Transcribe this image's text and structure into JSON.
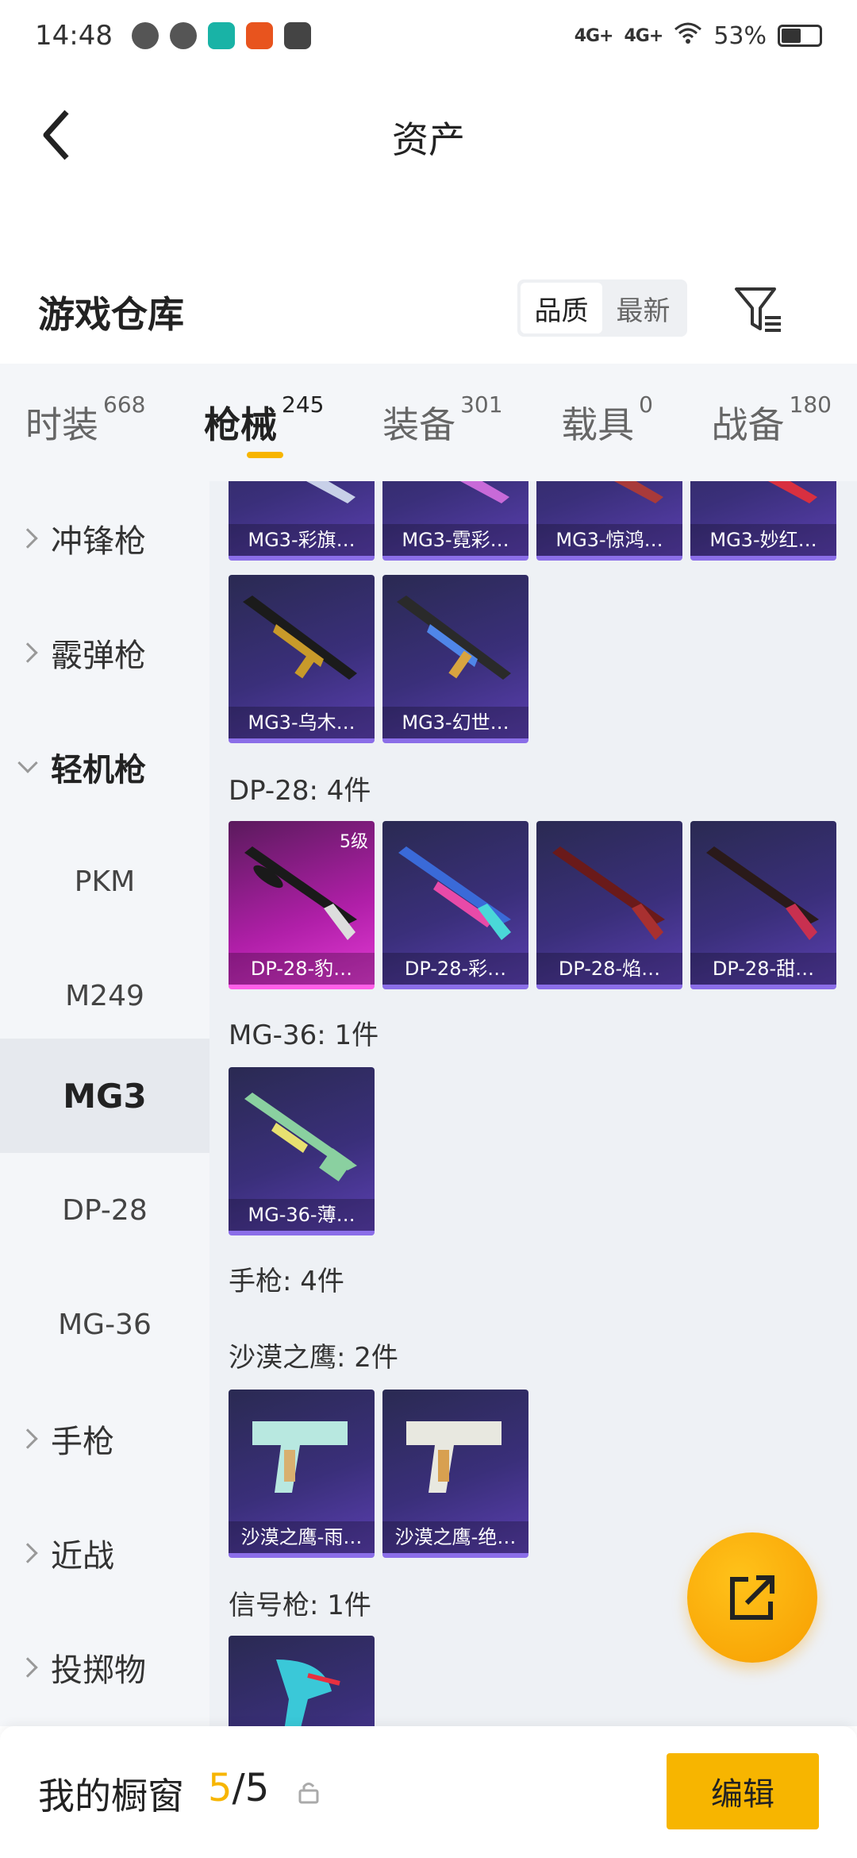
{
  "status_bar": {
    "time": "14:48",
    "network1": "4G+",
    "network2": "4G+",
    "battery": "53%"
  },
  "nav": {
    "title": "资产"
  },
  "warehouse": {
    "title": "游戏仓库",
    "sort_options": [
      "品质",
      "最新"
    ]
  },
  "tabs": [
    {
      "label": "时装",
      "count": "668"
    },
    {
      "label": "枪械",
      "count": "245"
    },
    {
      "label": "装备",
      "count": "301"
    },
    {
      "label": "载具",
      "count": "0"
    },
    {
      "label": "战备",
      "count": "180"
    }
  ],
  "sidebar": [
    {
      "label": "冲锋枪"
    },
    {
      "label": "霰弹枪"
    },
    {
      "label": "轻机枪"
    },
    {
      "label": "PKM"
    },
    {
      "label": "M249"
    },
    {
      "label": "MG3"
    },
    {
      "label": "DP-28"
    },
    {
      "label": "MG-36"
    },
    {
      "label": "手枪"
    },
    {
      "label": "近战"
    },
    {
      "label": "投掷物"
    }
  ],
  "sections": {
    "mg3_items": [
      "MG3-彩旗…",
      "MG3-霓彩…",
      "MG3-惊鸿…",
      "MG3-妙红…",
      "MG3-乌木…",
      "MG3-幻世…"
    ],
    "dp28_title": "DP-28: 4件",
    "dp28_items": [
      "DP-28-豹…",
      "DP-28-彩…",
      "DP-28-焰…",
      "DP-28-甜…"
    ],
    "dp28_level": "5级",
    "mg36_title": "MG-36: 1件",
    "mg36_items": [
      "MG-36-薄…"
    ],
    "pistol_title": "手枪: 4件",
    "deagle_title": "沙漠之鹰: 2件",
    "deagle_items": [
      "沙漠之鹰-雨…",
      "沙漠之鹰-绝…"
    ],
    "flare_title": "信号枪: 1件"
  },
  "bottom": {
    "label": "我的橱窗",
    "current": "5",
    "total": "/5",
    "edit": "编辑"
  }
}
